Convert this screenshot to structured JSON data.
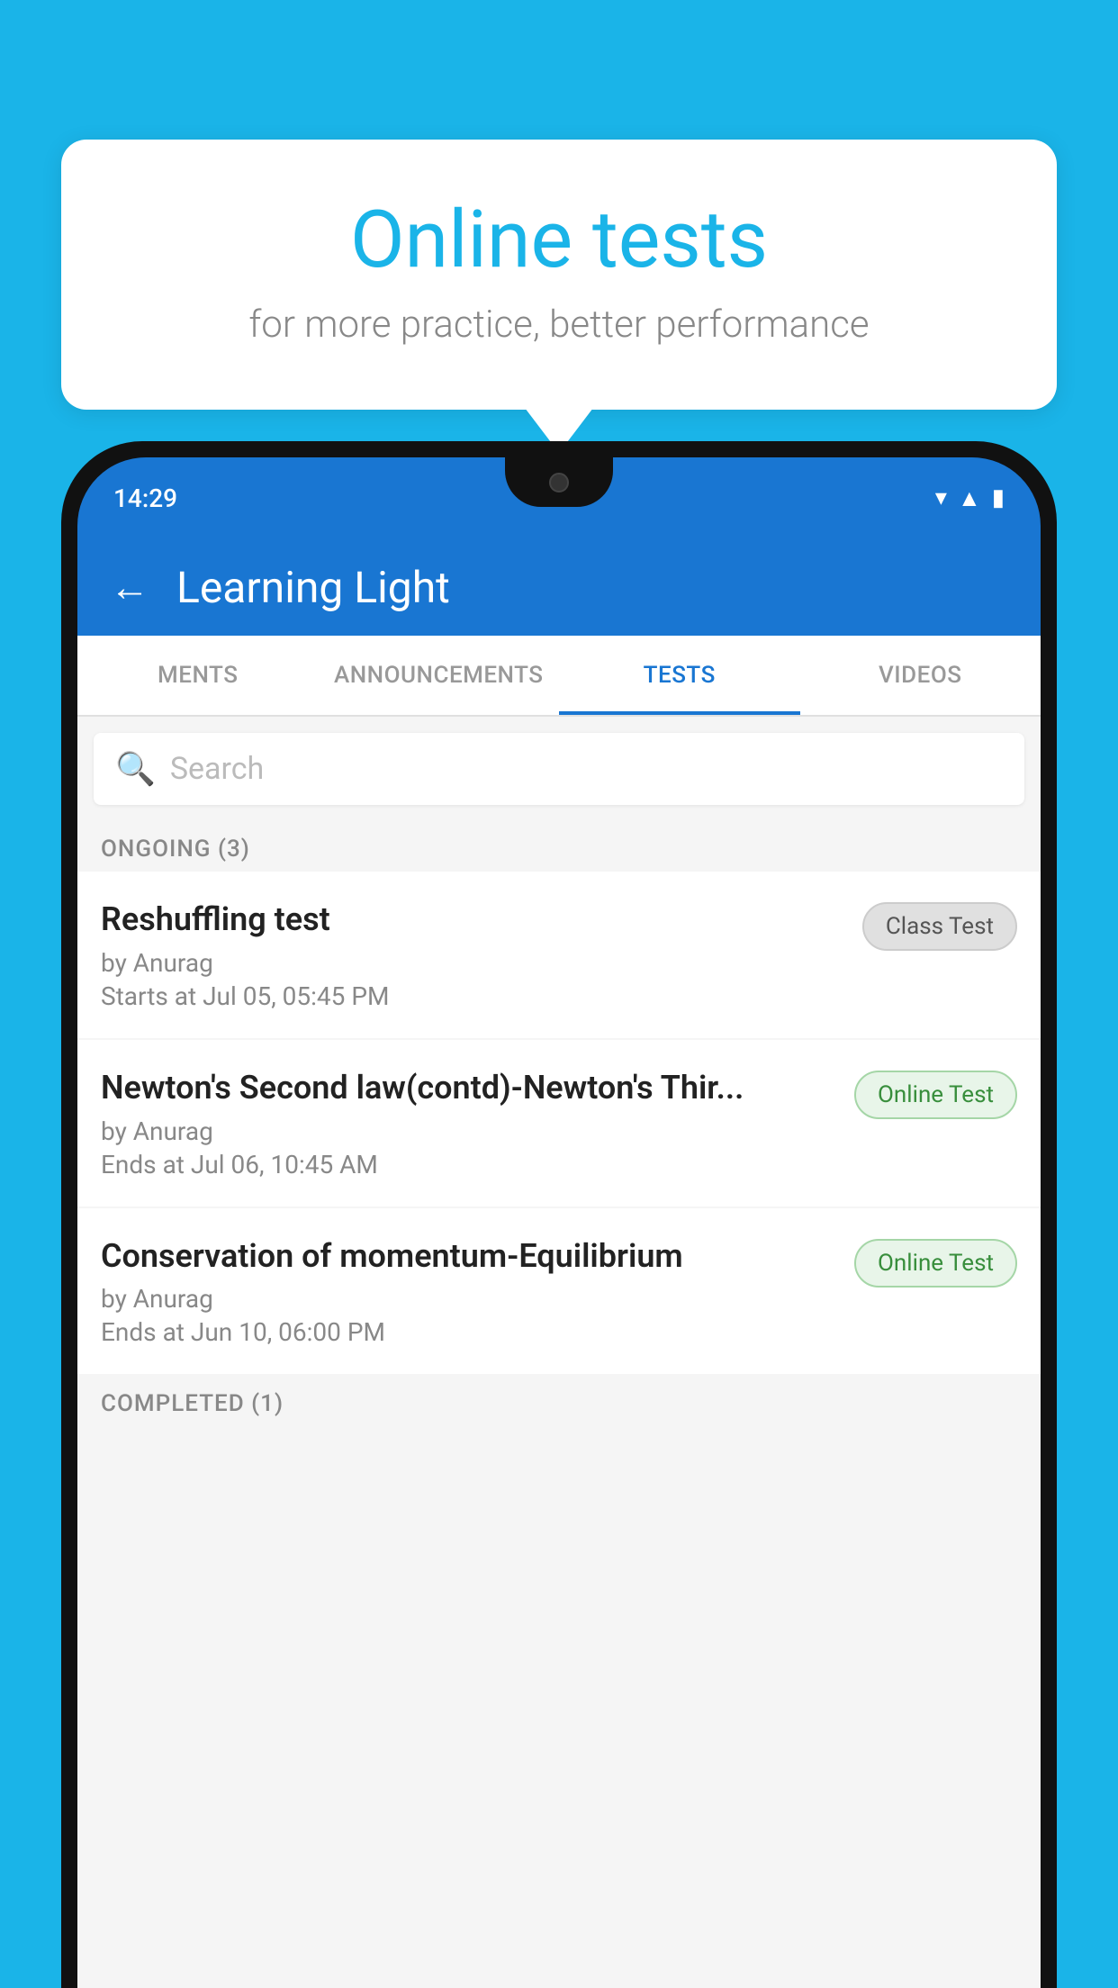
{
  "background": {
    "color": "#1ab4e8"
  },
  "bubble": {
    "title": "Online tests",
    "subtitle": "for more practice, better performance"
  },
  "phone": {
    "status_time": "14:29",
    "app_title": "Learning Light",
    "back_label": "←"
  },
  "tabs": [
    {
      "id": "ments",
      "label": "MENTS",
      "active": false
    },
    {
      "id": "announcements",
      "label": "ANNOUNCEMENTS",
      "active": false
    },
    {
      "id": "tests",
      "label": "TESTS",
      "active": true
    },
    {
      "id": "videos",
      "label": "VIDEOS",
      "active": false
    }
  ],
  "search": {
    "placeholder": "Search"
  },
  "sections": {
    "ongoing": {
      "label": "ONGOING (3)",
      "items": [
        {
          "name": "Reshuffling test",
          "by": "by Anurag",
          "time_label": "Starts at",
          "time": "Jul 05, 05:45 PM",
          "badge": "Class Test",
          "badge_type": "class"
        },
        {
          "name": "Newton's Second law(contd)-Newton's Thir...",
          "by": "by Anurag",
          "time_label": "Ends at",
          "time": "Jul 06, 10:45 AM",
          "badge": "Online Test",
          "badge_type": "online"
        },
        {
          "name": "Conservation of momentum-Equilibrium",
          "by": "by Anurag",
          "time_label": "Ends at",
          "time": "Jun 10, 06:00 PM",
          "badge": "Online Test",
          "badge_type": "online"
        }
      ]
    },
    "completed": {
      "label": "COMPLETED (1)"
    }
  }
}
